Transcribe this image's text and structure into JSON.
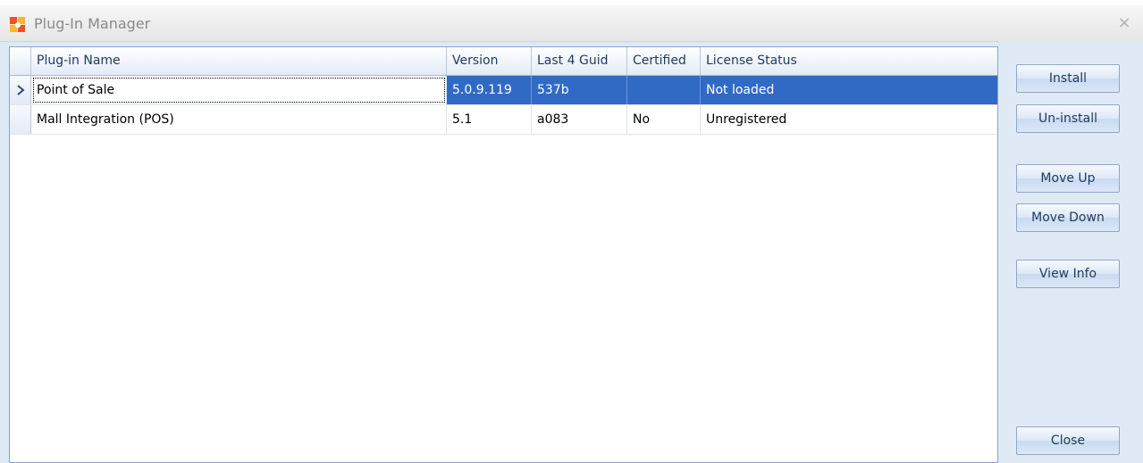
{
  "window": {
    "title": "Plug-In Manager",
    "close_glyph": "×"
  },
  "grid": {
    "columns": [
      "Plug-in Name",
      "Version",
      "Last 4 Guid",
      "Certified",
      "License Status"
    ],
    "rows": [
      {
        "name": "Point of Sale",
        "version": "5.0.9.119",
        "guid": "537b",
        "certified": "",
        "license": "Not loaded",
        "selected": true
      },
      {
        "name": "Mall Integration (POS)",
        "version": "5.1",
        "guid": "a083",
        "certified": "No",
        "license": "Unregistered",
        "selected": false
      }
    ]
  },
  "buttons": {
    "install": "Install",
    "uninstall": "Un-install",
    "move_up": "Move Up",
    "move_down": "Move Down",
    "view_info": "View Info",
    "close": "Close"
  },
  "icons": {
    "app": "plugin-app-icon",
    "close": "close-icon",
    "row_pointer": "row-pointer-icon"
  },
  "colors": {
    "selection": "#316ac5",
    "panel": "#dfe9f5",
    "header_text": "#1e3a5f"
  }
}
